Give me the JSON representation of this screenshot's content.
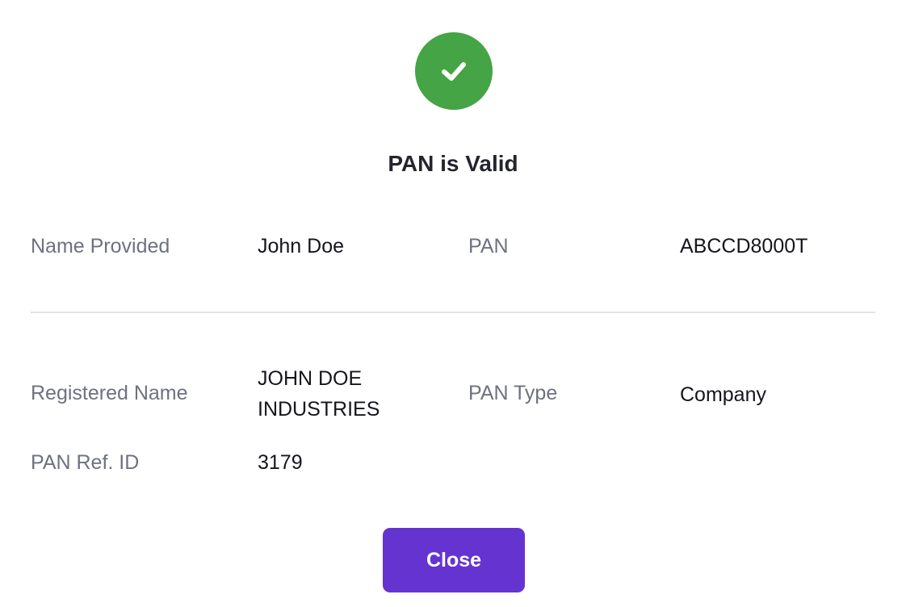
{
  "status": {
    "title": "PAN is Valid",
    "icon": "check-circle-icon",
    "color": "#45a445"
  },
  "details": {
    "name_provided_label": "Name Provided",
    "name_provided_value": "John Doe",
    "pan_label": "PAN",
    "pan_value": "ABCCD8000T",
    "registered_name_label": "Registered Name",
    "registered_name_line1": "JOHN DOE",
    "registered_name_line2": "INDUSTRIES",
    "pan_type_label": "PAN Type",
    "pan_type_value": "Company",
    "pan_ref_id_label": "PAN Ref. ID",
    "pan_ref_id_value": "3179"
  },
  "actions": {
    "close_label": "Close",
    "close_color": "#6534d0"
  }
}
